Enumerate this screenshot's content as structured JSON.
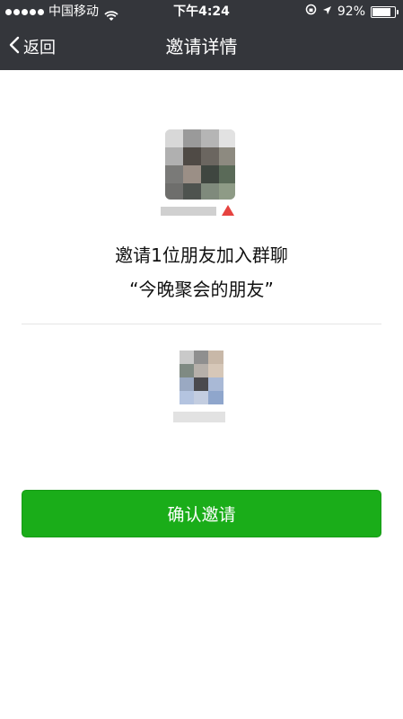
{
  "status_bar": {
    "carrier": "中国移动",
    "time": "下午4:24",
    "battery_percent": "92%",
    "battery_level": 0.92
  },
  "nav": {
    "back_label": "返回",
    "title": "邀请详情"
  },
  "invite": {
    "message": "邀请1位朋友加入群聊",
    "group_name": "“今晚聚会的朋友”"
  },
  "actions": {
    "confirm_label": "确认邀请",
    "confirm_color": "#1aad19"
  },
  "colors": {
    "topbar": "#34363b",
    "warning": "#e64340"
  }
}
